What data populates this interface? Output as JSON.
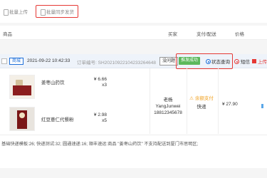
{
  "toolbar": {
    "upload_label": "批量上传",
    "sync_label": "批量同步发货"
  },
  "table_header": {
    "product": "商品",
    "buyer": "买家",
    "pay_ship": "支付/配送",
    "price": "价格"
  },
  "order": {
    "shop_tag": "商城",
    "datetime": "2021-09-22 10:42:33",
    "order_no_label": "订单编号: SH20210922104233264648",
    "no_issue_label": "没问题",
    "success_badge": "推发成功",
    "status_query": "状态查询",
    "sms_label": "短信",
    "upload_label": "上传",
    "items": [
      {
        "name": "姜枣山药饮",
        "price": "¥ 6.66",
        "qty": "x3"
      },
      {
        "name": "红豆薏仁代餐粉",
        "price": "¥ 2.98",
        "qty": "x5"
      }
    ],
    "buyer_name": "老杨 YangJunwei",
    "buyer_phone": "18812345678",
    "pay_status": "余额支付",
    "ship_method": "快递",
    "total_price": "¥ 27.90",
    "note": "基础快递模板:26;  快递测试:32;  圆通速递:16;  顺丰速运:商品 \"姜枣山药饮\" 不支持配送到厦门市思明区;"
  },
  "colors": {
    "accent_red": "#e53935",
    "success_green": "#5cb85c",
    "brand_blue": "#1e6fd9"
  }
}
